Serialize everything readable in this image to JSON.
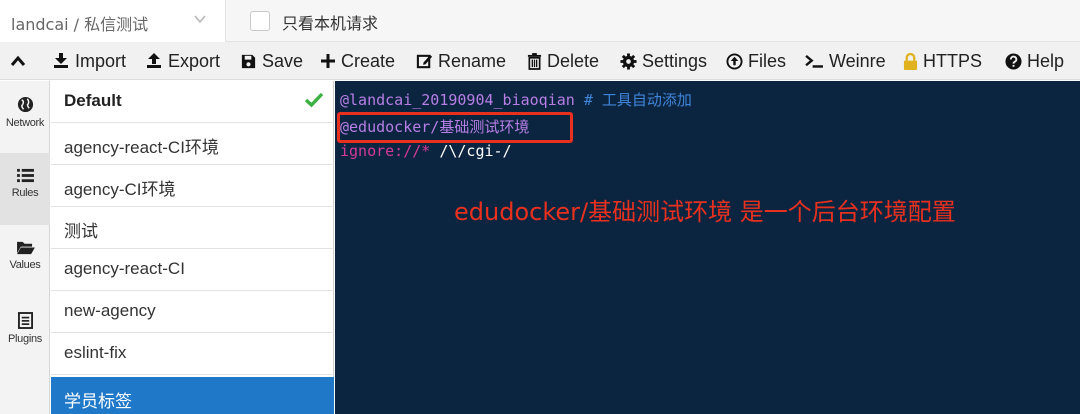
{
  "topbar": {
    "rule_select_value": "landcai / 私信测试",
    "local_only_label": "只看本机请求"
  },
  "toolbar": {
    "import_label": "Import",
    "export_label": "Export",
    "save_label": "Save",
    "create_label": "Create",
    "rename_label": "Rename",
    "delete_label": "Delete",
    "settings_label": "Settings",
    "files_label": "Files",
    "weinre_label": "Weinre",
    "https_label": "HTTPS",
    "help_label": "Help"
  },
  "nav": {
    "items": [
      {
        "label": "Network",
        "icon": "globe-icon"
      },
      {
        "label": "Rules",
        "icon": "list-icon"
      },
      {
        "label": "Values",
        "icon": "folder-icon"
      },
      {
        "label": "Plugins",
        "icon": "plugin-icon"
      }
    ]
  },
  "rules": {
    "items": [
      {
        "label": "Default"
      },
      {
        "label": "agency-react-CI环境"
      },
      {
        "label": "agency-CI环境"
      },
      {
        "label": "测试"
      },
      {
        "label": "agency-react-CI"
      },
      {
        "label": "new-agency"
      },
      {
        "label": "eslint-fix"
      },
      {
        "label": "学员标签"
      }
    ]
  },
  "editor": {
    "line1_at": "@landcai_20190904_biaoqian",
    "line1_comment": " # 工具自动添加",
    "line2": "@edudocker/基础测试环境",
    "line3_ignore": "ignore://*",
    "line3_regex": " /\\/cgi-/"
  },
  "annotation": {
    "text": "edudocker/基础测试环境 是一个后台环境配置"
  },
  "colors": {
    "editor_bg": "#0b2540",
    "selected_rule": "#1f78c8",
    "annotation_red": "#e8301f",
    "check_green": "#3cb043",
    "https_lock": "#e0b21f"
  }
}
